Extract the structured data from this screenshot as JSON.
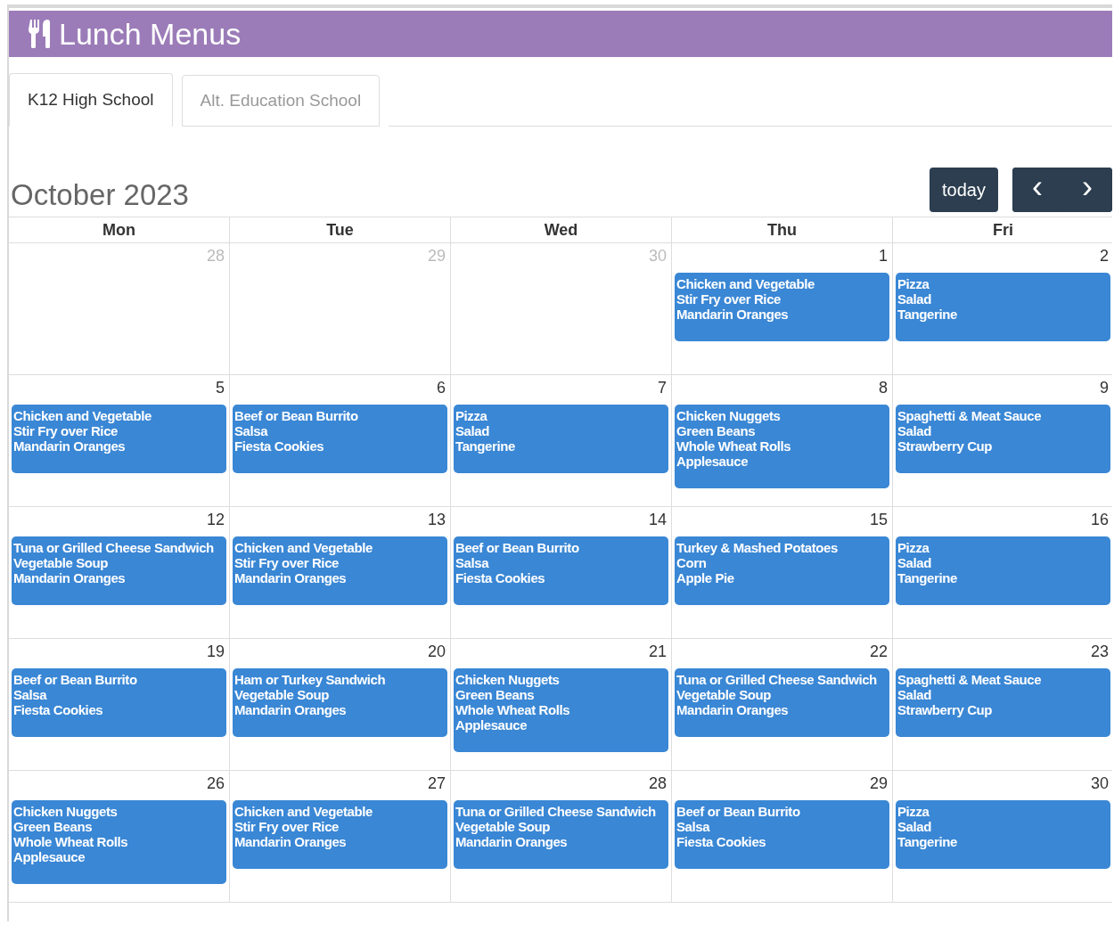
{
  "header": {
    "title": "Lunch Menus"
  },
  "tabs": [
    {
      "label": "K12 High School",
      "selected": true
    },
    {
      "label": "Alt. Education School",
      "selected": false
    }
  ],
  "calendar": {
    "title": "October 2023",
    "today_button": "today",
    "prev_button": "‹",
    "next_button": "›",
    "weekdays": [
      "Mon",
      "Tue",
      "Wed",
      "Thu",
      "Fri"
    ],
    "weeks": [
      [
        {
          "number": "28",
          "other_month": true
        },
        {
          "number": "29",
          "other_month": true
        },
        {
          "number": "30",
          "other_month": true
        },
        {
          "number": "1",
          "other_month": false,
          "meals": [
            "Chicken and Vegetable",
            "Stir Fry over Rice",
            "Mandarin Oranges"
          ]
        },
        {
          "number": "2",
          "other_month": false,
          "meals": [
            "Pizza",
            "Salad",
            "Tangerine"
          ]
        }
      ],
      [
        {
          "number": "5",
          "other_month": false,
          "meals": [
            "Chicken and Vegetable",
            "Stir Fry over Rice",
            "Mandarin Oranges"
          ]
        },
        {
          "number": "6",
          "other_month": false,
          "meals": [
            "Beef or Bean Burrito",
            "Salsa",
            "Fiesta Cookies"
          ]
        },
        {
          "number": "7",
          "other_month": false,
          "meals": [
            "Pizza",
            "Salad",
            "Tangerine"
          ]
        },
        {
          "number": "8",
          "other_month": false,
          "meals": [
            "Chicken Nuggets",
            "Green Beans",
            "Whole Wheat Rolls",
            "Applesauce"
          ]
        },
        {
          "number": "9",
          "other_month": false,
          "meals": [
            "Spaghetti & Meat Sauce",
            "Salad",
            "Strawberry Cup"
          ]
        }
      ],
      [
        {
          "number": "12",
          "other_month": false,
          "meals": [
            "Tuna or Grilled Cheese Sandwich",
            "Vegetable Soup",
            "Mandarin Oranges"
          ]
        },
        {
          "number": "13",
          "other_month": false,
          "meals": [
            "Chicken and Vegetable",
            "Stir Fry over Rice",
            "Mandarin Oranges"
          ]
        },
        {
          "number": "14",
          "other_month": false,
          "meals": [
            "Beef or Bean Burrito",
            "Salsa",
            "Fiesta Cookies"
          ]
        },
        {
          "number": "15",
          "other_month": false,
          "meals": [
            "Turkey & Mashed Potatoes",
            "Corn",
            "Apple Pie"
          ]
        },
        {
          "number": "16",
          "other_month": false,
          "meals": [
            "Pizza",
            "Salad",
            "Tangerine"
          ]
        }
      ],
      [
        {
          "number": "19",
          "other_month": false,
          "meals": [
            "Beef or Bean Burrito",
            "Salsa",
            "Fiesta Cookies"
          ]
        },
        {
          "number": "20",
          "other_month": false,
          "meals": [
            "Ham or Turkey Sandwich",
            "Vegetable Soup",
            "Mandarin Oranges"
          ]
        },
        {
          "number": "21",
          "other_month": false,
          "meals": [
            "Chicken Nuggets",
            "Green Beans",
            "Whole Wheat Rolls",
            "Applesauce"
          ]
        },
        {
          "number": "22",
          "other_month": false,
          "meals": [
            "Tuna or Grilled Cheese Sandwich",
            "Vegetable Soup",
            "Mandarin Oranges"
          ]
        },
        {
          "number": "23",
          "other_month": false,
          "meals": [
            "Spaghetti & Meat Sauce",
            "Salad",
            "Strawberry Cup"
          ]
        }
      ],
      [
        {
          "number": "26",
          "other_month": false,
          "meals": [
            "Chicken Nuggets",
            "Green Beans",
            "Whole Wheat Rolls",
            "Applesauce"
          ]
        },
        {
          "number": "27",
          "other_month": false,
          "meals": [
            "Chicken and Vegetable",
            "Stir Fry over Rice",
            "Mandarin Oranges"
          ]
        },
        {
          "number": "28",
          "other_month": false,
          "meals": [
            "Tuna or Grilled Cheese Sandwich",
            "Vegetable Soup",
            "Mandarin Oranges"
          ]
        },
        {
          "number": "29",
          "other_month": false,
          "meals": [
            "Beef or Bean Burrito",
            "Salsa",
            "Fiesta Cookies"
          ]
        },
        {
          "number": "30",
          "other_month": false,
          "meals": [
            "Pizza",
            "Salad",
            "Tangerine"
          ]
        }
      ]
    ]
  }
}
